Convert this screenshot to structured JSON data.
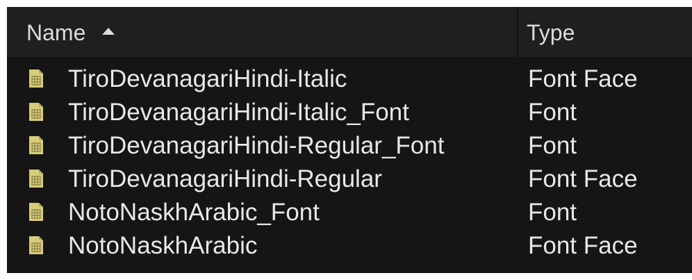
{
  "columns": {
    "name": "Name",
    "type": "Type",
    "sort_icon": "sort-ascending-icon"
  },
  "icon": {
    "name": "font-file-icon",
    "color": "#d8cc7a",
    "grid_color": "#7d7440"
  },
  "rows": [
    {
      "name": "TiroDevanagariHindi-Italic",
      "type": "Font Face"
    },
    {
      "name": "TiroDevanagariHindi-Italic_Font",
      "type": "Font"
    },
    {
      "name": "TiroDevanagariHindi-Regular_Font",
      "type": "Font"
    },
    {
      "name": "TiroDevanagariHindi-Regular",
      "type": "Font Face"
    },
    {
      "name": "NotoNaskhArabic_Font",
      "type": "Font"
    },
    {
      "name": "NotoNaskhArabic",
      "type": "Font Face"
    }
  ]
}
